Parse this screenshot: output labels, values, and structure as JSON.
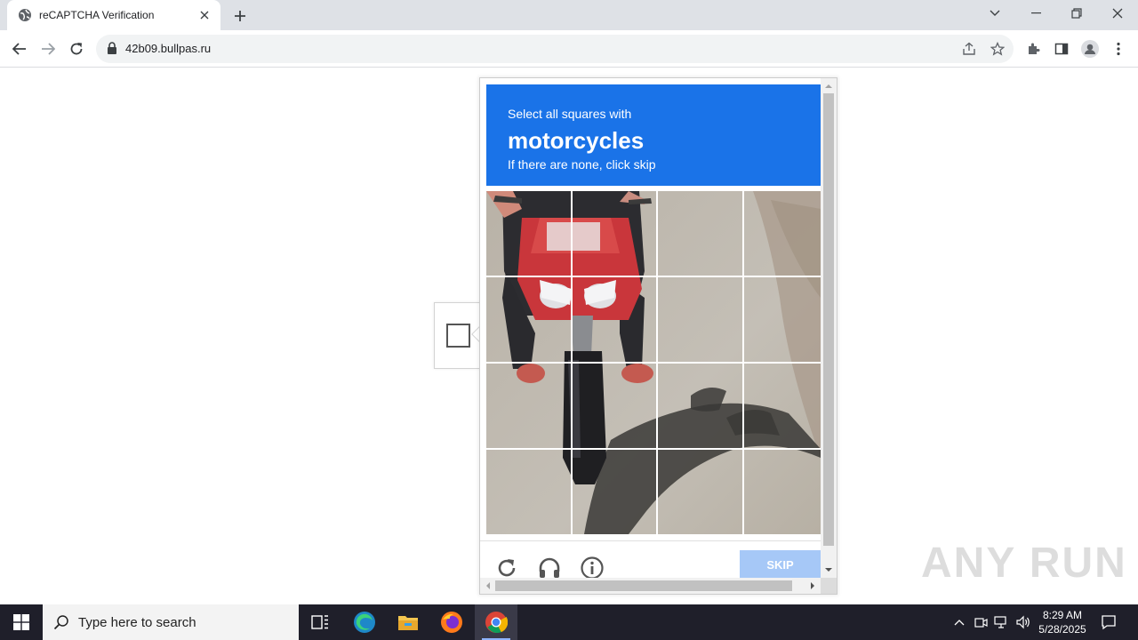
{
  "browser": {
    "tab_title": "reCAPTCHA Verification",
    "url": "42b09.bullpas.ru"
  },
  "captcha": {
    "instruction": "Select all squares with",
    "target": "motorcycles",
    "subtext": "If there are none, click skip",
    "skip_label": "SKIP",
    "accent_color": "#1a73e8",
    "skip_color": "#a6c8f7"
  },
  "watermark": "ANY RUN",
  "taskbar": {
    "search_placeholder": "Type here to search",
    "time": "8:29 AM",
    "date": "5/28/2025",
    "apps": [
      "task-view-icon",
      "edge-icon",
      "file-explorer-icon",
      "firefox-icon",
      "chrome-icon"
    ]
  }
}
